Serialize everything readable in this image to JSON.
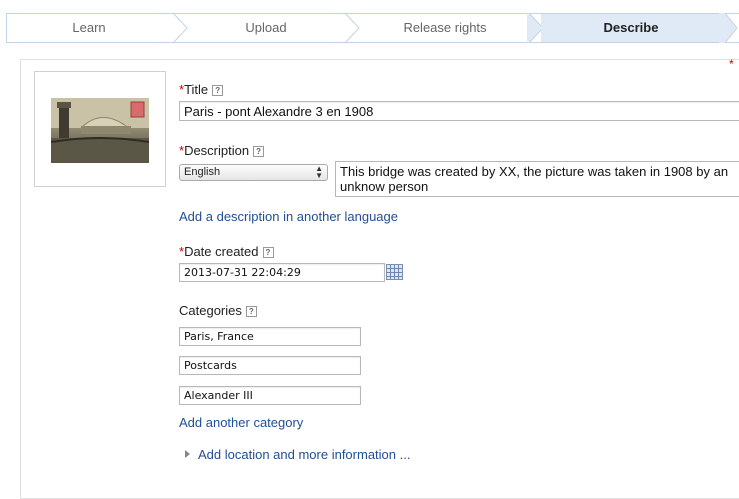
{
  "steps": [
    {
      "label": "Learn"
    },
    {
      "label": "Upload"
    },
    {
      "label": "Release rights"
    },
    {
      "label": "Describe"
    }
  ],
  "active_step": "Describe",
  "form": {
    "required_marker": "*",
    "help_glyph": "?",
    "title_label": "Title",
    "title_value": "Paris - pont Alexandre 3 en 1908",
    "description_label": "Description",
    "language_selected": "English",
    "description_value": "This bridge was created by XX, the picture was taken in 1908 by an unknow person",
    "add_description_link": "Add a description in another language",
    "date_label": "Date created",
    "date_value": "2013-07-31 22:04:29",
    "categories_label": "Categories",
    "categories": [
      "Paris, France",
      "Postcards",
      "Alexander III"
    ],
    "add_category_link": "Add another category",
    "more_info_link": "Add location and more information ..."
  },
  "icons": {
    "help": "help-icon",
    "calendar": "calendar-icon",
    "expand": "expand-triangle-icon",
    "select_arrows": "select-arrows-icon"
  },
  "colors": {
    "active_step_bg": "#dfeaf6",
    "step_border": "#c3d4e6",
    "link": "#1f4f94",
    "required": "#cc0000"
  }
}
